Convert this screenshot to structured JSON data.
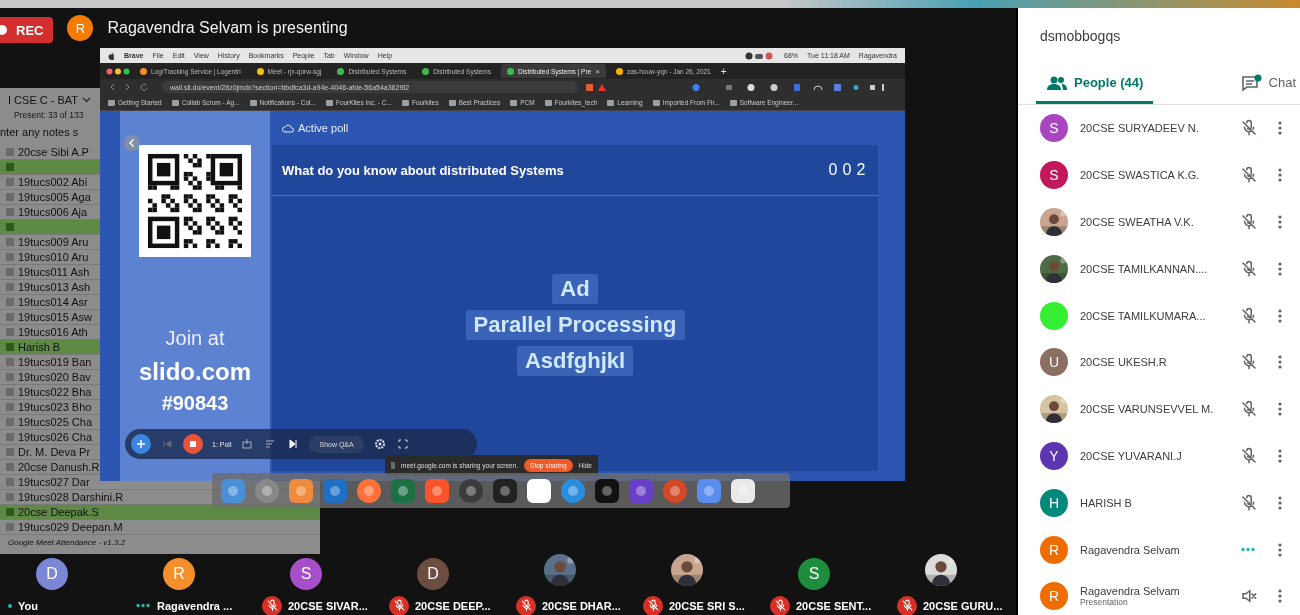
{
  "recording_badge": "REC",
  "presenter": {
    "initial": "R",
    "color": "#f57c00",
    "title": "Ragavendra Selvam is presenting"
  },
  "shared_screen": {
    "menu_bar": {
      "items": [
        "Brave",
        "File",
        "Edit",
        "View",
        "History",
        "Bookmarks",
        "People",
        "Tab",
        "Window",
        "Help"
      ],
      "status": [
        "68%",
        "Tue 11:18 AM",
        "Ragavendra"
      ]
    },
    "tabs": [
      {
        "label": "Log/Tracking Service | Logentri",
        "color": "#f28c28",
        "selected": false
      },
      {
        "label": "Meet - rjx-qorw-sgj",
        "color": "#f4c20d",
        "selected": false
      },
      {
        "label": "Distributed Systems",
        "color": "#3fb950",
        "selected": false
      },
      {
        "label": "Distributed Systems",
        "color": "#3fb950",
        "selected": false
      },
      {
        "label": "Distributed Systems | Pre",
        "color": "#3fb950",
        "selected": true
      },
      {
        "label": "zas-houw-yqn - Jan 26, 2021",
        "color": "#f4b400",
        "selected": false
      }
    ],
    "tab_close": "×",
    "new_tab": "+",
    "url": "wall.sli.do/event/28z0jmdx?section=bbdfca3d-a94e-4046-afde-56a54a3629f2",
    "bookmarks": [
      "Getting Started",
      "Collab Scrum - Ag...",
      "Notifications - Col...",
      "FourKites Inc. - C...",
      "Fourkites",
      "Best Practices",
      "PCM",
      "Fourkites_tech",
      "Learning",
      "Imported From Fir...",
      "Software Engineer..."
    ],
    "slido": {
      "status": "Active poll",
      "join_label": "Join at",
      "site": "slido.com",
      "code": "#90843",
      "question": "What do you know about distributed Systems",
      "counter": [
        "0",
        "0",
        "2"
      ],
      "answers": [
        "Ad",
        "Parallel Processing",
        "Asdfghjkl"
      ],
      "poll_selector": "1: Poll",
      "qa_button": "Show Q&A"
    },
    "share_notice": {
      "text": "meet.google.com is sharing your screen.",
      "stop": "Stop sharing",
      "hide": "Hide"
    }
  },
  "attendance": {
    "class_name": "I CSE C - BAT",
    "summary": "Present: 33 of 133",
    "notes_placeholder": "nter any notes s",
    "footer": "Google Meet Attendance - v1.3.2",
    "rows": [
      {
        "name": "20cse Sibi A.P",
        "checked": false
      },
      {
        "checked": true
      },
      {
        "name": "19tucs002 Abi",
        "checked": false
      },
      {
        "name": "19tucs005 Aga",
        "checked": false
      },
      {
        "name": "19tucs006 Aja",
        "checked": false
      },
      {
        "checked": true
      },
      {
        "name": "19tucs009 Aru",
        "checked": false
      },
      {
        "name": "19tucs010 Aru",
        "checked": false
      },
      {
        "name": "19tucs011 Ash",
        "checked": false
      },
      {
        "name": "19tucs013 Ash",
        "checked": false
      },
      {
        "name": "19tucs014 Asr",
        "checked": false
      },
      {
        "name": "19tucs015 Asw",
        "checked": false
      },
      {
        "name": "19tucs016 Ath",
        "checked": false
      },
      {
        "name": "Harish B",
        "checked": true
      },
      {
        "name": "19tucs019 Ban",
        "checked": false
      },
      {
        "name": "19tucs020 Bav",
        "checked": false
      },
      {
        "name": "19tucs022 Bha",
        "checked": false
      },
      {
        "name": "19tucs023 Bho",
        "checked": false
      },
      {
        "name": "19tucs025 Cha",
        "checked": false
      },
      {
        "name": "19tucs026 Cha",
        "checked": false
      },
      {
        "name": "Dr. M. Deva Pr",
        "checked": false
      },
      {
        "name": "20cse Danush.R",
        "checked": false
      },
      {
        "name": "19tucs027 Dar",
        "checked": false
      },
      {
        "name": "19tucs028 Darshini.R",
        "checked": false
      },
      {
        "name": "20cse Deepak.S",
        "checked": true
      },
      {
        "name": "19tucs029 Deepan.M",
        "checked": false
      }
    ]
  },
  "tiles": [
    {
      "name": "You",
      "avatar": {
        "kind": "letter",
        "letter": "D",
        "color": "#7b86d4"
      },
      "kind": "idle"
    },
    {
      "name": "Ragavendra ...",
      "avatar": {
        "kind": "letter",
        "letter": "R",
        "color": "#f4902c"
      },
      "kind": "speaking"
    },
    {
      "name": "20CSE SIVAR...",
      "avatar": {
        "kind": "letter",
        "letter": "S",
        "color": "#a64fc9"
      },
      "kind": "muted"
    },
    {
      "name": "20CSE DEEP...",
      "avatar": {
        "kind": "letter",
        "letter": "D",
        "color": "#6d4c41"
      },
      "kind": "muted"
    },
    {
      "name": "20CSE DHAR...",
      "kind": "muted"
    },
    {
      "name": "20CSE SRI S...",
      "kind": "muted"
    },
    {
      "name": "20CSE SENT...",
      "avatar": {
        "kind": "letter",
        "letter": "S",
        "color": "#1e8e3e"
      },
      "kind": "muted"
    },
    {
      "name": "20CSE GURU...",
      "kind": "muted"
    }
  ],
  "panel": {
    "meeting_code": "dsmobbogqs",
    "tabs": [
      {
        "label": "People (44)",
        "kind": "people",
        "selected": true
      },
      {
        "label": "Chat",
        "kind": "chat",
        "selected": false
      }
    ],
    "people": [
      {
        "name": "20CSE SURYADEEV N.",
        "avatar": {
          "kind": "letter",
          "letter": "S",
          "color": "#a846c0"
        },
        "kind": "muted"
      },
      {
        "name": "20CSE SWASTICA K.G.",
        "avatar": {
          "kind": "letter",
          "letter": "S",
          "color": "#c2185b"
        },
        "kind": "muted"
      },
      {
        "name": "20CSE SWEATHA V.K.",
        "kind": "muted"
      },
      {
        "name": "20CSE TAMILKANNAN....",
        "kind": "muted"
      },
      {
        "name": "20CSE TAMILKUMARA...",
        "avatar": {
          "kind": "blank",
          "color": "#33ee33"
        },
        "kind": "muted"
      },
      {
        "name": "20CSE UKESH.R",
        "avatar": {
          "kind": "letter",
          "letter": "U",
          "color": "#8d6e63"
        },
        "kind": "muted"
      },
      {
        "name": "20CSE VARUNSEVVEL M.",
        "kind": "muted"
      },
      {
        "name": "20CSE YUVARANI.J",
        "avatar": {
          "kind": "letter",
          "letter": "Y",
          "color": "#5e35b1"
        },
        "kind": "muted"
      },
      {
        "name": "HARISH B",
        "avatar": {
          "kind": "letter",
          "letter": "H",
          "color": "#00897b"
        },
        "kind": "muted"
      },
      {
        "name": "Ragavendra Selvam",
        "avatar": {
          "kind": "letter",
          "letter": "R",
          "color": "#ef6c00"
        },
        "kind": "speaking"
      },
      {
        "name": "Ragavendra Selvam",
        "subtitle": "Presentation",
        "avatar": {
          "kind": "letter",
          "letter": "R",
          "color": "#ef6c00"
        },
        "kind": "sound_off"
      }
    ]
  }
}
